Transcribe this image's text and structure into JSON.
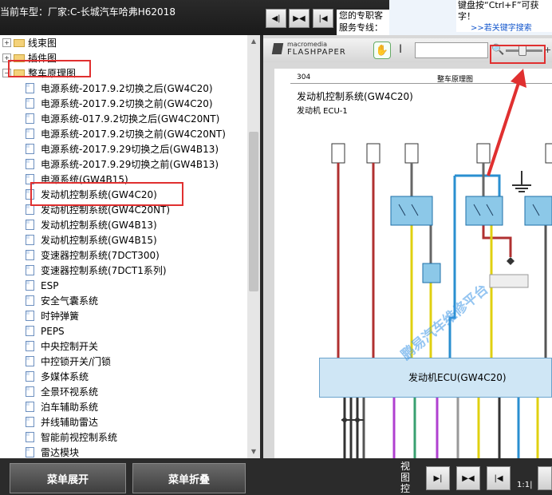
{
  "header": {
    "model_label": "当前车型：厂家:C-长城汽车哈弗H62018",
    "nav_buttons": [
      "◀|",
      "▶◀",
      "|◀"
    ],
    "hotline_line1": "您的专职客",
    "hotline_line2": "服务专线：",
    "ctrlf_line1": "键盘按“Ctrl+F”可获",
    "ctrlf_line2": "字！",
    "ctrlf_link": ">>若关键字搜索"
  },
  "tree": {
    "folders": [
      {
        "label": "线束图",
        "expander": "+"
      },
      {
        "label": "插件图",
        "expander": "+"
      },
      {
        "label": "整车原理图",
        "expander": "−"
      }
    ],
    "items": [
      "电源系统-2017.9.2切换之后(GW4C20)",
      "电源系统-2017.9.2切换之前(GW4C20)",
      "电源系统-017.9.2切换之后(GW4C20NT)",
      "电源系统-2017.9.2切换之前(GW4C20NT)",
      "电源系统-2017.9.29切换之后(GW4B13)",
      "电源系统-2017.9.29切换之前(GW4B13)",
      "电源系统(GW4B15)",
      "发动机控制系统(GW4C20)",
      "发动机控制系统(GW4C20NT)",
      "发动机控制系统(GW4B13)",
      "发动机控制系统(GW4B15)",
      "变速器控制系统(7DCT300)",
      "变速器控制系统(7DCT1系列)",
      "ESP",
      "安全气囊系统",
      "时钟弹簧",
      "PEPS",
      "中央控制开关",
      "中控锁开关/门锁",
      "多媒体系统",
      "全景环视系统",
      "泊车辅助系统",
      "并线辅助雷达",
      "智能前视控制系统",
      "雷达模块"
    ]
  },
  "viewer": {
    "brand_small": "macromedia",
    "brand_big": "FLASHPAPER",
    "page_number": "304",
    "page_header": "整车原理图",
    "title": "发动机控制系统(GW4C20)",
    "subtitle": "发动机 ECU-1",
    "ecu_label": "发动机ECU(GW4C20)",
    "watermark": "鹏易汽车维修平台"
  },
  "bottom": {
    "expand_label": "菜单展开",
    "collapse_label": "菜单折叠",
    "view_label_1": "视",
    "view_label_2": "图",
    "view_label_3": "控",
    "page_indicator": "1:1|"
  },
  "colors": {
    "highlight": "#e03030",
    "ecu_box": "#cfe6f5"
  }
}
